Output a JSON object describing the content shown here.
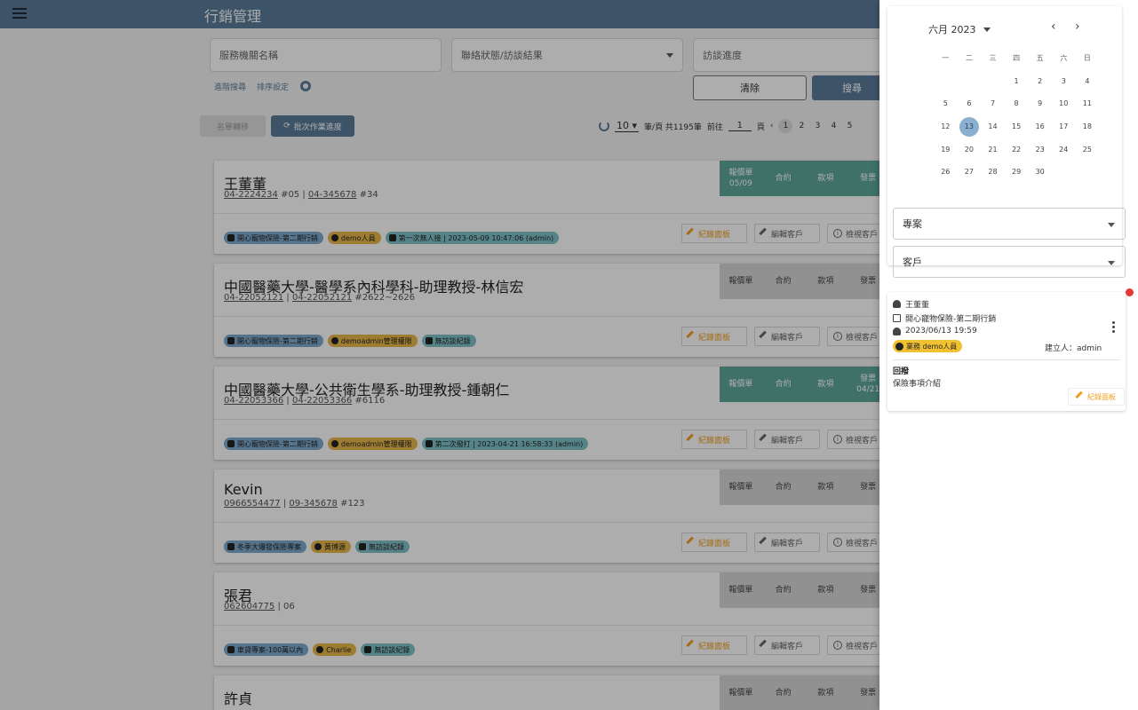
{
  "header": {
    "title": "行銷管理"
  },
  "search": {
    "agency_placeholder": "服務機關名稱",
    "contact_status_placeholder": "聯絡狀態/訪談結果",
    "progress_placeholder": "訪談進度",
    "advanced_link": "進階搜尋",
    "sort_link": "排序設定",
    "clear_label": "清除",
    "search_label": "搜尋"
  },
  "toolbar": {
    "transfer_label": "名單轉移",
    "batch_label": "批次作業進度"
  },
  "pager": {
    "page_size": "10",
    "per_page_text": "筆/頁 共1195筆",
    "goto_label": "前往",
    "goto_value": "1",
    "page_suffix": "頁",
    "pages": [
      "1",
      "2",
      "3",
      "4",
      "5"
    ],
    "current_page": "1"
  },
  "status_labels": [
    "報價單",
    "合約",
    "款項",
    "發票"
  ],
  "card_buttons": {
    "record": "紀錄面板",
    "edit": "編輯客戶",
    "view": "檢視客戶"
  },
  "cards": [
    {
      "name": "王董董",
      "phone1": "04-2224234",
      "ext1": "#05",
      "phone2": "04-345678",
      "ext2": "#34",
      "status_sub": [
        "05/09",
        "",
        "",
        ""
      ],
      "tags": [
        "開心寵物保險-第二期行銷",
        "demo人員",
        "第一次無人接 | 2023-05-09 10:47:06 (admin)"
      ]
    },
    {
      "name": "中國醫藥大學-醫學系內科學科-助理教授-林信宏",
      "phone1": "04-22052121",
      "ext1": "",
      "phone2": "04-22052121",
      "ext2": "#2622~2626",
      "status_sub": [
        "",
        "",
        "",
        ""
      ],
      "tags": [
        "開心寵物保險-第二期行銷",
        "demoadmin管理權限",
        "無訪談紀錄"
      ]
    },
    {
      "name": "中國醫藥大學-公共衛生學系-助理教授-鍾朝仁",
      "phone1": "04-22053366",
      "ext1": "",
      "phone2": "04-22053366",
      "ext2": "#6116",
      "status_sub": [
        "",
        "",
        "",
        "04/21"
      ],
      "tags": [
        "開心寵物保險-第二期行銷",
        "demoadmin管理權限",
        "第二次撥打 | 2023-04-21 16:58:33 (admin)"
      ]
    },
    {
      "name": "Kevin",
      "phone1": "0966554477",
      "ext1": "",
      "phone2": "09-345678",
      "ext2": "#123",
      "status_sub": [
        "",
        "",
        "",
        ""
      ],
      "tags": [
        "冬季大爆發保險專案",
        "黃博源",
        "無訪談紀錄"
      ]
    },
    {
      "name": "張君",
      "phone1": "062604775",
      "ext1": "",
      "phone2": "",
      "ext2": "06",
      "status_sub": [
        "",
        "",
        "",
        ""
      ],
      "tags": [
        "車貸專案-100萬以內",
        "Charlie",
        "無訪談紀錄"
      ]
    },
    {
      "name": "許貞",
      "phone1": "",
      "ext1": "",
      "phone2": "",
      "ext2": "",
      "status_sub": [
        "",
        "",
        "",
        ""
      ],
      "tags": []
    }
  ],
  "calendar": {
    "month_label": "六月 2023",
    "weekdays": [
      "一",
      "二",
      "三",
      "四",
      "五",
      "六",
      "日"
    ],
    "days": [
      "",
      "",
      "",
      "1",
      "2",
      "3",
      "4",
      "5",
      "6",
      "7",
      "8",
      "9",
      "10",
      "11",
      "12",
      "13",
      "14",
      "15",
      "16",
      "17",
      "18",
      "19",
      "20",
      "21",
      "22",
      "23",
      "24",
      "25",
      "26",
      "27",
      "28",
      "29",
      "30"
    ],
    "selected_day": "13"
  },
  "filters": {
    "project_label": "專案",
    "customer_label": "客戶"
  },
  "task": {
    "customer": "王董董",
    "project": "開心寵物保險-第二期行銷",
    "reminder": "2023/06/13 19:59",
    "owner_tag": "業務 demo人員",
    "creator": "建立人：admin",
    "result_label": "回撥",
    "result_text": "保險事項介紹",
    "record_label": "紀錄面板"
  },
  "colors": {
    "primary": "#5b7d9a",
    "status_green": "#5ea79b",
    "tag_yellow": "#e8b84b",
    "accent_orange": "#f0a020",
    "alert_red": "#e53935"
  }
}
